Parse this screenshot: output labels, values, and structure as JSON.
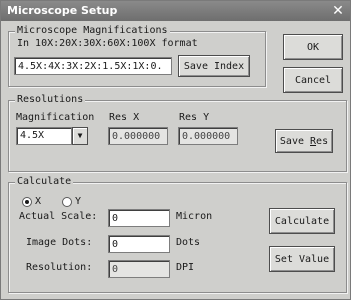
{
  "window": {
    "title": "Microscope Setup",
    "close_glyph": "✕"
  },
  "magnifications": {
    "legend": "Microscope Magnifications",
    "hint": "In 10X:20X:30X:60X:100X format",
    "value": "4.5X:4X:3X:2X:1.5X:1X:0.",
    "save_label": "Save Index"
  },
  "dialog": {
    "ok_label": "OK",
    "cancel_label": "Cancel"
  },
  "resolutions": {
    "legend": "Resolutions",
    "magnification_label": "Magnification",
    "res_x_label": "Res X",
    "res_y_label": "Res Y",
    "magnification_value": "4.5X",
    "res_x_value": "0.000000",
    "res_y_value": "0.000000",
    "save_res_label": "Save Res",
    "dropdown_icon": "chevron-down-icon"
  },
  "calculate": {
    "legend": "Calculate",
    "axis": {
      "x_label": "X",
      "y_label": "Y",
      "selected": "X"
    },
    "actual_scale_label": "Actual Scale:",
    "actual_scale_value": "0",
    "actual_scale_unit": "Micron",
    "image_dots_label": "Image Dots:",
    "image_dots_value": "0",
    "image_dots_unit": "Dots",
    "resolution_label": "Resolution:",
    "resolution_value": "0",
    "resolution_unit": "DPI",
    "calculate_label": "Calculate",
    "set_value_label": "Set Value"
  },
  "colors": {
    "titlebar": "#7a7a7a",
    "dialog_bg": "#cfcfcc"
  }
}
